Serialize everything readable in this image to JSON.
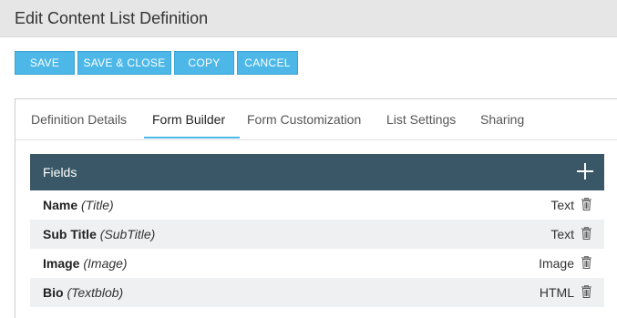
{
  "window": {
    "title": "Edit Content List Definition"
  },
  "toolbar": {
    "save": "SAVE",
    "save_close": "SAVE & CLOSE",
    "copy": "COPY",
    "cancel": "CANCEL"
  },
  "tabs": [
    {
      "label": "Definition Details"
    },
    {
      "label": "Form Builder",
      "active": true
    },
    {
      "label": "Form Customization"
    },
    {
      "label": "List Settings"
    },
    {
      "label": "Sharing"
    }
  ],
  "fields_panel": {
    "header": "Fields",
    "add_icon": "plus-icon",
    "rows": [
      {
        "name": "Name",
        "key": "(Title)",
        "type": "Text"
      },
      {
        "name": "Sub Title",
        "key": "(SubTitle)",
        "type": "Text"
      },
      {
        "name": "Image",
        "key": "(Image)",
        "type": "Image"
      },
      {
        "name": "Bio",
        "key": "(Textblob)",
        "type": "HTML"
      }
    ],
    "row_icon": "trash-icon"
  },
  "colors": {
    "accent": "#4db8e8",
    "header_bg": "#3a5767",
    "titlebar_bg": "#e6e6e6"
  }
}
